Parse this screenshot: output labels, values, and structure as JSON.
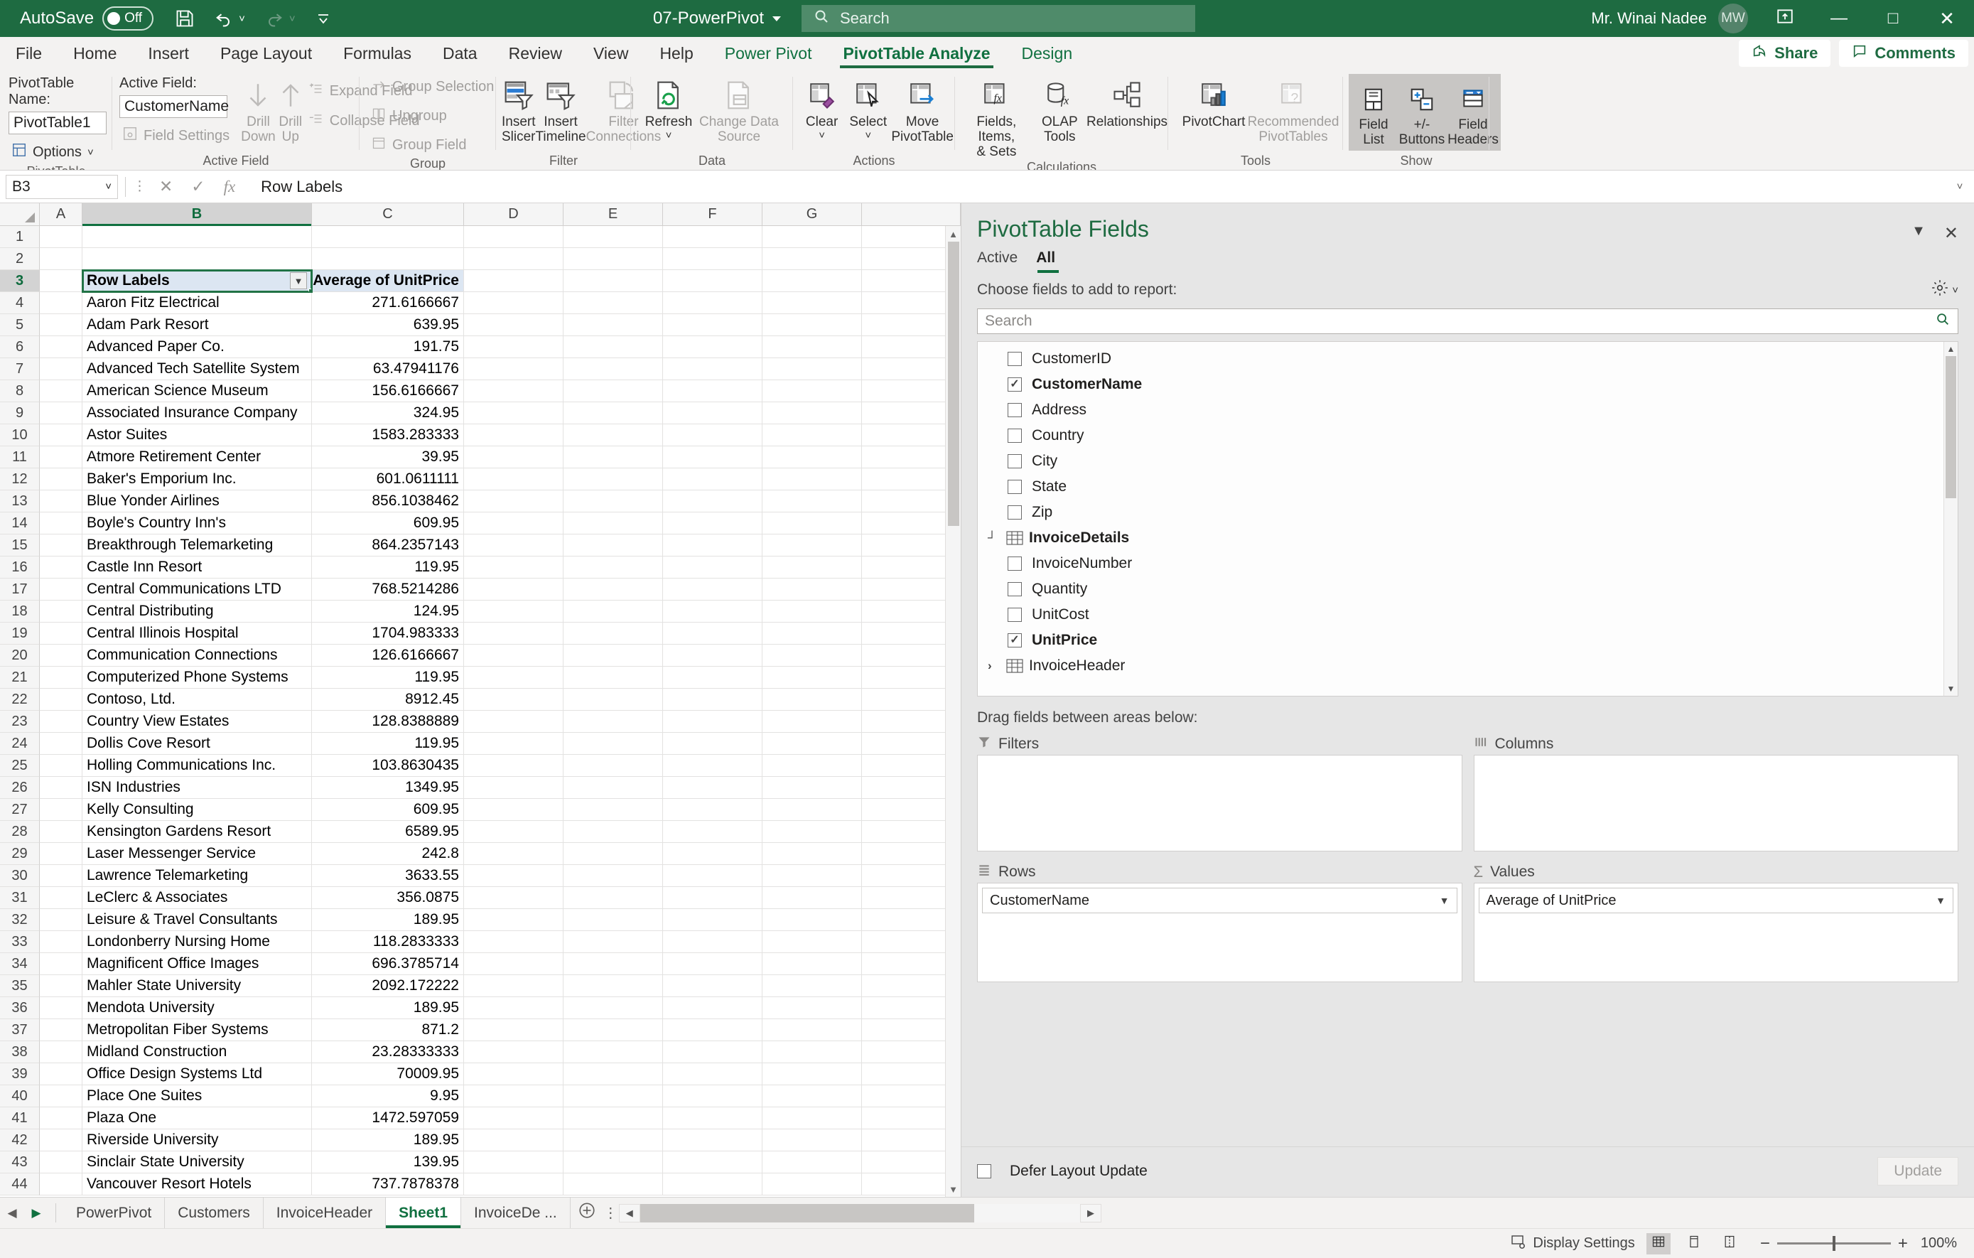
{
  "titlebar": {
    "autosave_label": "AutoSave",
    "autosave_state": "Off",
    "save_icon": "save-icon",
    "undo_icon": "undo-icon",
    "redo_icon": "redo-icon",
    "customize_icon": "customize-quick-access-icon",
    "document_title": "07-PowerPivot",
    "search_placeholder": "Search",
    "search_icon": "search-icon",
    "user_name": "Mr. Winai  Nadee",
    "user_initials": "MW",
    "ribbon_display_icon": "ribbon-display-options-icon",
    "minimize": "—",
    "maximize": "□",
    "close": "✕"
  },
  "ribbon_tabs": {
    "items": [
      {
        "label": "File"
      },
      {
        "label": "Home"
      },
      {
        "label": "Insert"
      },
      {
        "label": "Page Layout"
      },
      {
        "label": "Formulas"
      },
      {
        "label": "Data"
      },
      {
        "label": "Review"
      },
      {
        "label": "View"
      },
      {
        "label": "Help"
      },
      {
        "label": "Power Pivot"
      },
      {
        "label": "PivotTable Analyze"
      },
      {
        "label": "Design"
      }
    ],
    "active": "PivotTable Analyze",
    "share_label": "Share",
    "comments_label": "Comments"
  },
  "ribbon": {
    "groups": [
      {
        "name": "PivotTable",
        "label": "PivotTable",
        "pivottable_name_label": "PivotTable Name:",
        "pivottable_name_value": "PivotTable1",
        "options_label": "Options"
      },
      {
        "name": "Active Field",
        "label": "Active Field",
        "active_field_label": "Active Field:",
        "active_field_value": "CustomerName",
        "field_settings_label": "Field Settings",
        "drill_down_label_1": "Drill",
        "drill_down_label_2": "Down",
        "drill_up_label_1": "Drill",
        "drill_up_label_2": "Up",
        "expand_field_label": "Expand Field",
        "collapse_field_label": "Collapse Field"
      },
      {
        "name": "Group",
        "label": "Group",
        "group_selection_label": "Group Selection",
        "ungroup_label": "Ungroup",
        "group_field_label": "Group Field"
      },
      {
        "name": "Filter",
        "label": "Filter",
        "insert_slicer_1": "Insert",
        "insert_slicer_2": "Slicer",
        "insert_timeline_1": "Insert",
        "insert_timeline_2": "Timeline",
        "filter_connections_1": "Filter",
        "filter_connections_2": "Connections"
      },
      {
        "name": "Data",
        "label": "Data",
        "refresh_label": "Refresh",
        "change_data_source_1": "Change Data",
        "change_data_source_2": "Source"
      },
      {
        "name": "Actions",
        "label": "Actions",
        "clear_label": "Clear",
        "select_label": "Select",
        "move_pivottable_1": "Move",
        "move_pivottable_2": "PivotTable"
      },
      {
        "name": "Calculations",
        "label": "Calculations",
        "fields_items_sets_1": "Fields, Items,",
        "fields_items_sets_2": "& Sets",
        "olap_tools_1": "OLAP",
        "olap_tools_2": "Tools",
        "relationships_label": "Relationships"
      },
      {
        "name": "Tools",
        "label": "Tools",
        "pivotchart_label": "PivotChart",
        "recommended_1": "Recommended",
        "recommended_2": "PivotTables"
      },
      {
        "name": "Show",
        "label": "Show",
        "field_list_1": "Field",
        "field_list_2": "List",
        "plusminus_1": "+/-",
        "plusminus_2": "Buttons",
        "field_headers_1": "Field",
        "field_headers_2": "Headers"
      }
    ]
  },
  "formula_bar": {
    "name_box_value": "B3",
    "cancel_icon": "cancel-icon",
    "enter_icon": "enter-icon",
    "function_icon": "insert-function-icon",
    "formula_value": "Row Labels",
    "expand_icon": "expand-formula-bar-icon"
  },
  "grid": {
    "columns": [
      "A",
      "B",
      "C",
      "D",
      "E",
      "F",
      "G"
    ],
    "selected_column": "B",
    "selected_row": "3",
    "selected_cell": "B3",
    "header_row_number": 3,
    "header": {
      "row_labels": "Row Labels",
      "value_header": "Average of UnitPrice",
      "filter_icon": "filter-dropdown-icon"
    },
    "first_data_row": 4,
    "rows": [
      {
        "n": 4,
        "label": "Aaron Fitz Electrical",
        "value": "271.6166667"
      },
      {
        "n": 5,
        "label": "Adam Park Resort",
        "value": "639.95"
      },
      {
        "n": 6,
        "label": "Advanced Paper Co.",
        "value": "191.75"
      },
      {
        "n": 7,
        "label": "Advanced Tech Satellite System",
        "value": "63.47941176"
      },
      {
        "n": 8,
        "label": "American Science Museum",
        "value": "156.6166667"
      },
      {
        "n": 9,
        "label": "Associated Insurance Company",
        "value": "324.95"
      },
      {
        "n": 10,
        "label": "Astor Suites",
        "value": "1583.283333"
      },
      {
        "n": 11,
        "label": "Atmore Retirement Center",
        "value": "39.95"
      },
      {
        "n": 12,
        "label": "Baker's Emporium Inc.",
        "value": "601.0611111"
      },
      {
        "n": 13,
        "label": "Blue Yonder Airlines",
        "value": "856.1038462"
      },
      {
        "n": 14,
        "label": "Boyle's Country Inn's",
        "value": "609.95"
      },
      {
        "n": 15,
        "label": "Breakthrough Telemarketing",
        "value": "864.2357143"
      },
      {
        "n": 16,
        "label": "Castle Inn Resort",
        "value": "119.95"
      },
      {
        "n": 17,
        "label": "Central Communications LTD",
        "value": "768.5214286"
      },
      {
        "n": 18,
        "label": "Central Distributing",
        "value": "124.95"
      },
      {
        "n": 19,
        "label": "Central Illinois Hospital",
        "value": "1704.983333"
      },
      {
        "n": 20,
        "label": "Communication Connections",
        "value": "126.6166667"
      },
      {
        "n": 21,
        "label": "Computerized Phone Systems",
        "value": "119.95"
      },
      {
        "n": 22,
        "label": "Contoso, Ltd.",
        "value": "8912.45"
      },
      {
        "n": 23,
        "label": "Country View Estates",
        "value": "128.8388889"
      },
      {
        "n": 24,
        "label": "Dollis Cove Resort",
        "value": "119.95"
      },
      {
        "n": 25,
        "label": "Holling Communications Inc.",
        "value": "103.8630435"
      },
      {
        "n": 26,
        "label": "ISN Industries",
        "value": "1349.95"
      },
      {
        "n": 27,
        "label": "Kelly Consulting",
        "value": "609.95"
      },
      {
        "n": 28,
        "label": "Kensington Gardens Resort",
        "value": "6589.95"
      },
      {
        "n": 29,
        "label": "Laser Messenger Service",
        "value": "242.8"
      },
      {
        "n": 30,
        "label": "Lawrence Telemarketing",
        "value": "3633.55"
      },
      {
        "n": 31,
        "label": "LeClerc & Associates",
        "value": "356.0875"
      },
      {
        "n": 32,
        "label": "Leisure & Travel Consultants",
        "value": "189.95"
      },
      {
        "n": 33,
        "label": "Londonberry Nursing Home",
        "value": "118.2833333"
      },
      {
        "n": 34,
        "label": "Magnificent Office Images",
        "value": "696.3785714"
      },
      {
        "n": 35,
        "label": "Mahler State University",
        "value": "2092.172222"
      },
      {
        "n": 36,
        "label": "Mendota University",
        "value": "189.95"
      },
      {
        "n": 37,
        "label": "Metropolitan Fiber Systems",
        "value": "871.2"
      },
      {
        "n": 38,
        "label": "Midland Construction",
        "value": "23.28333333"
      },
      {
        "n": 39,
        "label": "Office Design Systems Ltd",
        "value": "70009.95"
      },
      {
        "n": 40,
        "label": "Place One Suites",
        "value": "9.95"
      },
      {
        "n": 41,
        "label": "Plaza One",
        "value": "1472.597059"
      },
      {
        "n": 42,
        "label": "Riverside University",
        "value": "189.95"
      },
      {
        "n": 43,
        "label": "Sinclair State University",
        "value": "139.95"
      },
      {
        "n": 44,
        "label": "Vancouver Resort Hotels",
        "value": "737.7878378"
      }
    ]
  },
  "pane": {
    "title": "PivotTable Fields",
    "collapse_icon": "chevron-down-icon",
    "close_icon": "close-icon",
    "tabs": [
      {
        "label": "Active",
        "active": false
      },
      {
        "label": "All",
        "active": true
      }
    ],
    "choose_label": "Choose fields to add to report:",
    "tools_icon": "gear-icon",
    "search_placeholder": "Search",
    "search_icon": "search-icon",
    "fields": [
      {
        "label": "CustomerID",
        "checked": false,
        "type": "field"
      },
      {
        "label": "CustomerName",
        "checked": true,
        "type": "field"
      },
      {
        "label": "Address",
        "checked": false,
        "type": "field"
      },
      {
        "label": "Country",
        "checked": false,
        "type": "field"
      },
      {
        "label": "City",
        "checked": false,
        "type": "field"
      },
      {
        "label": "State",
        "checked": false,
        "type": "field"
      },
      {
        "label": "Zip",
        "checked": false,
        "type": "field"
      },
      {
        "label": "InvoiceDetails",
        "checked": false,
        "type": "table",
        "expanded": true
      },
      {
        "label": "InvoiceNumber",
        "checked": false,
        "type": "field"
      },
      {
        "label": "Quantity",
        "checked": false,
        "type": "field"
      },
      {
        "label": "UnitCost",
        "checked": false,
        "type": "field"
      },
      {
        "label": "UnitPrice",
        "checked": true,
        "type": "field"
      },
      {
        "label": "InvoiceHeader",
        "checked": false,
        "type": "table",
        "expanded": false
      }
    ],
    "drag_label": "Drag fields between areas below:",
    "areas": [
      {
        "name": "filters",
        "label": "Filters",
        "icon": "filter-icon",
        "chips": []
      },
      {
        "name": "columns",
        "label": "Columns",
        "icon": "columns-icon",
        "chips": []
      },
      {
        "name": "rows",
        "label": "Rows",
        "icon": "rows-icon",
        "chips": [
          {
            "label": "CustomerName",
            "dropdown": true
          }
        ]
      },
      {
        "name": "values",
        "label": "Values",
        "icon": "sigma-icon",
        "chips": [
          {
            "label": "Average of UnitPrice",
            "dropdown": false
          }
        ]
      }
    ],
    "defer_label": "Defer Layout Update",
    "defer_checked": false,
    "update_label": "Update"
  },
  "sheets": {
    "prev_icon": "previous-sheet-icon",
    "next_icon": "next-sheet-icon",
    "tabs": [
      {
        "label": "PowerPivot",
        "active": false
      },
      {
        "label": "Customers",
        "active": false
      },
      {
        "label": "InvoiceHeader",
        "active": false
      },
      {
        "label": "Sheet1",
        "active": true
      },
      {
        "label": "InvoiceDe ...",
        "active": false
      }
    ],
    "add_sheet": "+",
    "more_sheets": "⋮"
  },
  "statusbar": {
    "display_settings_label": "Display Settings",
    "display_settings_icon": "display-settings-icon",
    "view_normal_icon": "normal-view-icon",
    "view_pagelayout_icon": "page-layout-view-icon",
    "view_pagebreak_icon": "page-break-preview-icon",
    "zoom_out": "−",
    "zoom_in": "+",
    "zoom_level": "100%"
  },
  "colors": {
    "brand_green": "#1e6b41",
    "accent_green": "#107040",
    "ribbon_bg": "#f3f2f1",
    "pane_bg": "#e6e6e6",
    "header_cell_bg": "#dce6f2"
  }
}
